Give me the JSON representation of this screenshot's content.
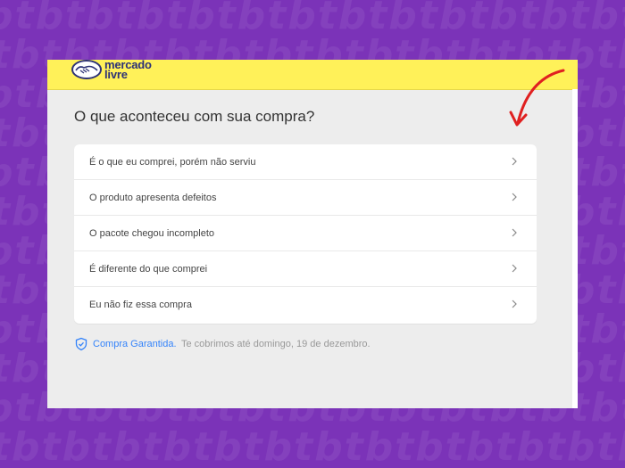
{
  "brand": {
    "logo_line1": "mercado",
    "logo_line2": "livre",
    "yellow": "#fff159",
    "navy": "#2d3277"
  },
  "page": {
    "title": "O que aconteceu com sua compra?"
  },
  "options": [
    {
      "label": "É o que eu comprei, porém não serviu",
      "icon": "chevron-right-icon"
    },
    {
      "label": "O produto apresenta defeitos",
      "icon": "chevron-right-icon"
    },
    {
      "label": "O pacote chegou incompleto",
      "icon": "chevron-right-icon"
    },
    {
      "label": "É diferente do que comprei",
      "icon": "chevron-right-icon"
    },
    {
      "label": "Eu não fiz essa compra",
      "icon": "chevron-right-icon"
    }
  ],
  "guarantee": {
    "icon": "shield-check-icon",
    "link_label": "Compra Garantida.",
    "text": "Te cobrimos até domingo, 19 de dezembro.",
    "link_color": "#3483fa"
  },
  "annotation": {
    "icon": "red-curved-arrow-icon",
    "color": "#e02020"
  },
  "background": {
    "color": "#7b33b8"
  }
}
